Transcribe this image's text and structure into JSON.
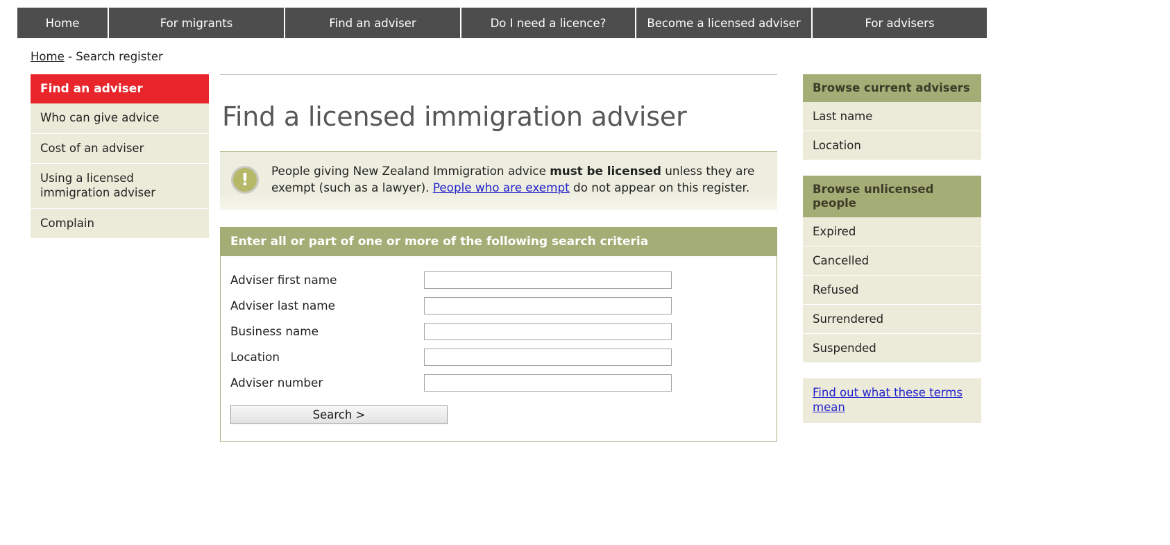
{
  "nav": {
    "items": [
      {
        "label": "Home"
      },
      {
        "label": "For migrants"
      },
      {
        "label": "Find an adviser"
      },
      {
        "label": "Do I need a licence?"
      },
      {
        "label": "Become a licensed adviser"
      },
      {
        "label": "For advisers"
      }
    ]
  },
  "breadcrumb": {
    "home": "Home",
    "separator": " - ",
    "current": "Search register"
  },
  "sidebar": {
    "heading": "Find an adviser",
    "items": [
      {
        "label": "Who can give advice"
      },
      {
        "label": "Cost of an adviser"
      },
      {
        "label": "Using a licensed immigration adviser"
      },
      {
        "label": "Complain"
      }
    ]
  },
  "main": {
    "title": "Find a licensed immigration adviser",
    "notice": {
      "icon": "exclamation-icon",
      "text_part1": "People giving New Zealand Immigration advice ",
      "text_bold": "must be licensed",
      "text_part2": " unless they are exempt (such as a lawyer). ",
      "link_text": "People who are exempt",
      "text_part3": " do not appear on this register."
    },
    "search_form": {
      "heading": "Enter all or part of one or more of the following search criteria",
      "fields": [
        {
          "label": "Adviser first name",
          "value": "",
          "placeholder": ""
        },
        {
          "label": "Adviser last name",
          "value": "",
          "placeholder": ""
        },
        {
          "label": "Business name",
          "value": "",
          "placeholder": ""
        },
        {
          "label": "Location",
          "value": "",
          "placeholder": ""
        },
        {
          "label": "Adviser number",
          "value": "",
          "placeholder": ""
        }
      ],
      "submit_label": "Search >"
    }
  },
  "rightcol": {
    "browse_current": {
      "heading": "Browse current advisers",
      "items": [
        {
          "label": "Last name"
        },
        {
          "label": "Location"
        }
      ]
    },
    "browse_unlicensed": {
      "heading": "Browse unlicensed people",
      "items": [
        {
          "label": "Expired"
        },
        {
          "label": "Cancelled"
        },
        {
          "label": "Refused"
        },
        {
          "label": "Surrendered"
        },
        {
          "label": "Suspended"
        }
      ]
    },
    "terms_link": "Find out what these terms mean"
  },
  "colors": {
    "nav_bg": "#4d4d4d",
    "accent_red": "#e8252a",
    "accent_olive": "#a5ad76",
    "panel_cream": "#ecead8",
    "link_blue": "#2222cc",
    "title_gray": "#575757"
  }
}
